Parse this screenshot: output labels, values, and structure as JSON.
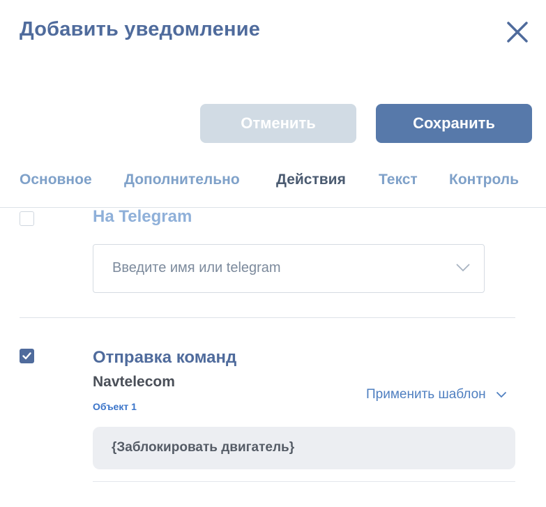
{
  "dialog": {
    "title": "Добавить уведомление"
  },
  "buttons": {
    "cancel": "Отменить",
    "save": "Сохранить"
  },
  "tabs": [
    {
      "label": "Основное",
      "active": false
    },
    {
      "label": "Дополнительно",
      "active": false
    },
    {
      "label": "Действия",
      "active": true
    },
    {
      "label": "Текст",
      "active": false
    },
    {
      "label": "Контроль",
      "active": false
    }
  ],
  "telegram": {
    "checked": false,
    "title": "На Telegram",
    "input_placeholder": "Введите имя или telegram"
  },
  "commands": {
    "checked": true,
    "title": "Отправка команд",
    "device": "Navtelecom",
    "object": "Объект 1",
    "apply_template": "Применить шаблон",
    "command_text": "{Заблокировать двигатель}"
  },
  "icons": {
    "close": "close-icon",
    "chevron": "chevron-down-icon",
    "check": "check-icon"
  },
  "colors": {
    "primary": "#5779aa",
    "title": "#4f6b9c",
    "disabled_button": "#d1dbe4",
    "link": "#4f7fc0"
  }
}
